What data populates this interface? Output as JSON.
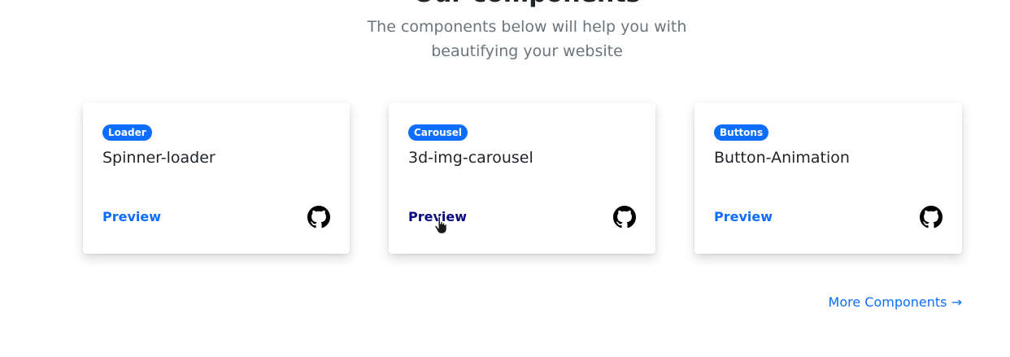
{
  "section": {
    "title": "Our components",
    "subtitle": "The components below will help you with beautifying your website"
  },
  "cards": [
    {
      "badge": "Loader",
      "title": "Spinner-loader",
      "preview_label": "Preview",
      "icon": "github-icon"
    },
    {
      "badge": "Carousel",
      "title": "3d-img-carousel",
      "preview_label": "Preview",
      "icon": "github-icon"
    },
    {
      "badge": "Buttons",
      "title": "Button-Animation",
      "preview_label": "Preview",
      "icon": "github-icon"
    }
  ],
  "more_link": "More Components →",
  "colors": {
    "accent": "#0d6efd",
    "text": "#212529",
    "muted": "#6c757d",
    "hover": "#0a0a80"
  }
}
